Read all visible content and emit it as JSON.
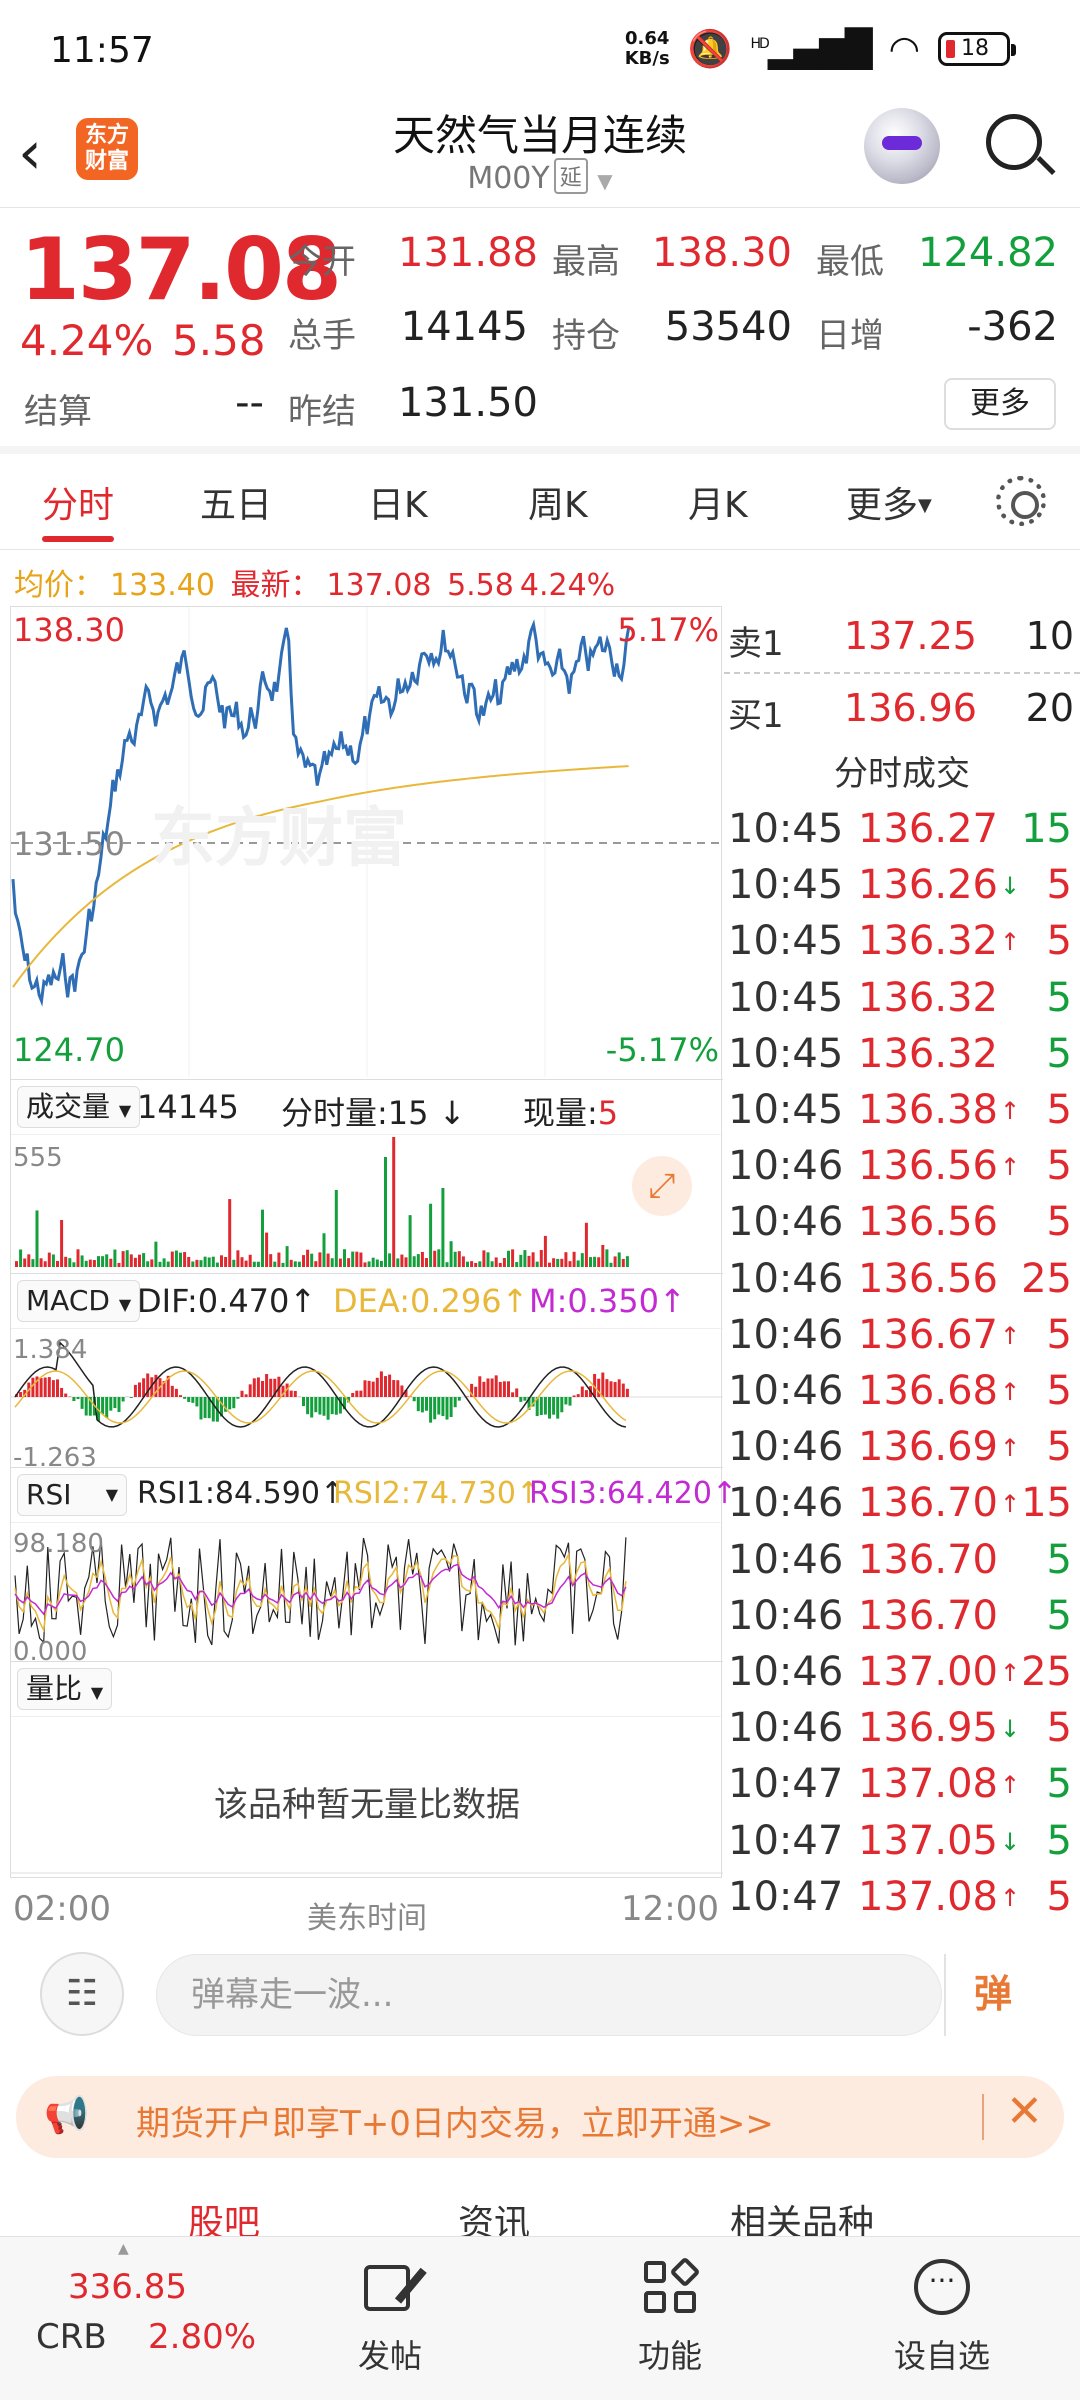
{
  "status_bar": {
    "time": "11:57",
    "net_speed": "0.64",
    "net_unit": "KB/s",
    "signal": "HD",
    "battery": "18"
  },
  "header": {
    "logo": "东方财富",
    "title": "天然气当月连续",
    "code": "M00Y",
    "tag": "延"
  },
  "quote": {
    "price": "137.08",
    "change_pct": "4.24%",
    "change": "5.58",
    "open_label": "今开",
    "open": "131.88",
    "high_label": "最高",
    "high": "138.30",
    "low_label": "最低",
    "low": "124.82",
    "volume_label": "总手",
    "volume": "14145",
    "oi_label": "持仓",
    "oi": "53540",
    "daily_inc_label": "日增",
    "daily_inc": "-362",
    "settle_label": "结算",
    "settle": "--",
    "prev_settle_label": "昨结",
    "prev_settle": "131.50",
    "more_label": "更多"
  },
  "tabs": [
    "分时",
    "五日",
    "日K",
    "周K",
    "月K",
    "更多"
  ],
  "avg_bar": {
    "avg_label": "均价：",
    "avg": "133.40",
    "latest_label": "最新：",
    "latest": "137.08",
    "chg": "5.58",
    "pct": "4.24%"
  },
  "chart": {
    "max_price": "138.30",
    "max_pct": "5.17%",
    "ref_price": "131.50",
    "min_price": "124.70",
    "min_pct": "-5.17%",
    "watermark": "东方财富",
    "vol_header": {
      "dd": "成交量",
      "total": "14145",
      "min_vol_label": "分时量:",
      "min_vol": "15",
      "now_label": "现量:",
      "now": "5"
    },
    "vol_max": "555",
    "macd_header": {
      "dd": "MACD",
      "dif": "DIF:0.470",
      "dea": "DEA:0.296",
      "m": "M:0.350"
    },
    "macd_max": "1.384",
    "macd_min": "-1.263",
    "rsi_header": {
      "dd": "RSI",
      "rsi1": "RSI1:84.590",
      "rsi2": "RSI2:74.730",
      "rsi3": "RSI3:64.420"
    },
    "rsi_max": "98.180",
    "rsi_min": "0.000",
    "ratio_header": {
      "dd": "量比"
    },
    "ratio_empty": "该品种暂无量比数据",
    "time_start": "02:00",
    "time_label": "美东时间",
    "time_end": "12:00"
  },
  "orderbook": {
    "sell": {
      "label": "卖1",
      "price": "137.25",
      "qty": "10"
    },
    "buy": {
      "label": "买1",
      "price": "136.96",
      "qty": "20"
    },
    "ticks_title": "分时成交",
    "ticks": [
      {
        "time": "10:45",
        "price": "136.27",
        "arrow": "",
        "vol": "15",
        "vcolor": "green"
      },
      {
        "time": "10:45",
        "price": "136.26",
        "arrow": "↓",
        "vol": "5",
        "vcolor": "red"
      },
      {
        "time": "10:45",
        "price": "136.32",
        "arrow": "↑",
        "vol": "5",
        "vcolor": "red"
      },
      {
        "time": "10:45",
        "price": "136.32",
        "arrow": "",
        "vol": "5",
        "vcolor": "green"
      },
      {
        "time": "10:45",
        "price": "136.32",
        "arrow": "",
        "vol": "5",
        "vcolor": "green"
      },
      {
        "time": "10:45",
        "price": "136.38",
        "arrow": "↑",
        "vol": "5",
        "vcolor": "red"
      },
      {
        "time": "10:46",
        "price": "136.56",
        "arrow": "↑",
        "vol": "5",
        "vcolor": "red"
      },
      {
        "time": "10:46",
        "price": "136.56",
        "arrow": "",
        "vol": "5",
        "vcolor": "red"
      },
      {
        "time": "10:46",
        "price": "136.56",
        "arrow": "",
        "vol": "25",
        "vcolor": "red"
      },
      {
        "time": "10:46",
        "price": "136.67",
        "arrow": "↑",
        "vol": "5",
        "vcolor": "red"
      },
      {
        "time": "10:46",
        "price": "136.68",
        "arrow": "↑",
        "vol": "5",
        "vcolor": "red"
      },
      {
        "time": "10:46",
        "price": "136.69",
        "arrow": "↑",
        "vol": "5",
        "vcolor": "red"
      },
      {
        "time": "10:46",
        "price": "136.70",
        "arrow": "↑",
        "vol": "15",
        "vcolor": "red"
      },
      {
        "time": "10:46",
        "price": "136.70",
        "arrow": "",
        "vol": "5",
        "vcolor": "green"
      },
      {
        "time": "10:46",
        "price": "136.70",
        "arrow": "",
        "vol": "5",
        "vcolor": "green"
      },
      {
        "time": "10:46",
        "price": "137.00",
        "arrow": "↑",
        "vol": "25",
        "vcolor": "red"
      },
      {
        "time": "10:46",
        "price": "136.95",
        "arrow": "↓",
        "vol": "5",
        "vcolor": "red"
      },
      {
        "time": "10:47",
        "price": "137.08",
        "arrow": "↑",
        "vol": "5",
        "vcolor": "green"
      },
      {
        "time": "10:47",
        "price": "137.05",
        "arrow": "↓",
        "vol": "5",
        "vcolor": "green"
      },
      {
        "time": "10:47",
        "price": "137.08",
        "arrow": "↑",
        "vol": "5",
        "vcolor": "red"
      }
    ]
  },
  "comment": {
    "placeholder": "弹幕走一波...",
    "danmu": "弹"
  },
  "promo": {
    "text": "期货开户即享T+0日内交易，立即开通>>"
  },
  "subtabs": [
    "股吧",
    "资讯",
    "相关品种"
  ],
  "bottom_nav": {
    "crb_price": "336.85",
    "crb_name": "CRB",
    "crb_pct": "2.80%",
    "items": [
      "发帖",
      "功能",
      "设自选"
    ]
  },
  "colors": {
    "up": "#e0292f",
    "down": "#13a03c",
    "accent": "#e87935",
    "price_line": "#2f6db5",
    "avg_line": "#e8b83a"
  }
}
